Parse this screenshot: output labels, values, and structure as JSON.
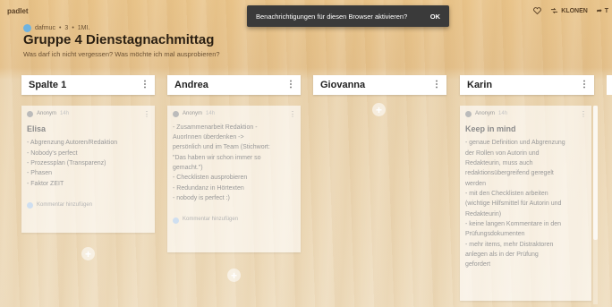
{
  "app": {
    "brand": "padlet"
  },
  "actions": {
    "like_icon": "heart-icon",
    "clone_label": "KLONEN",
    "clone_icon": "clone-icon",
    "more_label": "T"
  },
  "header": {
    "author": "dafmuc",
    "meta_sep": "•",
    "meta_count": "3",
    "meta_sep2": "•",
    "meta_time": "1MI.",
    "title": "Gruppe 4 Dienstagnachmittag",
    "subtitle": "Was darf ich nicht vergessen? Was möchte ich mal ausprobieren?"
  },
  "toast": {
    "message": "Benachrichtigungen für diesen Browser aktivieren?",
    "ok_label": "OK"
  },
  "columns": [
    {
      "title": "Spalte 1"
    },
    {
      "title": "Andrea"
    },
    {
      "title": "Giovanna"
    },
    {
      "title": "Karin"
    }
  ],
  "cards": [
    {
      "author": "Anonym",
      "time": "14h",
      "title": "Elisa",
      "body": "- Abgrenzung Autoren/Redaktion\n- Nobody's perfect\n- Prozessplan (Transparenz)\n- Phasen\n- Faktor ZEIT",
      "comment": "Kommentar hinzufügen"
    },
    {
      "author": "Anonym",
      "time": "14h",
      "title": "",
      "body": "- Zusammenarbeit Redaktion -\nAuorInnen überdenken ->\npersönlich und im Team (Stichwort:\n\"Das haben wir schon immer so\ngemacht.\")\n- Checklisten ausprobieren\n- Redundanz in Hörtexten\n- nobody is perfect :)",
      "comment": "Kommentar hinzufügen"
    },
    {
      "author": "Anonym",
      "time": "14h",
      "title": "Keep in mind",
      "body": "- genaue Definition und Abgrenzung\nder Rollen von Autorin und\nRedakteurin, muss auch\nredaktionsübergreifend geregelt\nwerden\n- mit den Checklisten arbeiten\n(wichtige Hilfsmittel für Autorin und\nRedakteurin)\n- keine langen Kommentare in den\nPrüfungsdokumenten\n- mehr items, mehr Distraktoren\nanlegen als in der Prüfung\ngefordert"
    }
  ],
  "add_symbol": "+",
  "menu_symbol": "⋮"
}
